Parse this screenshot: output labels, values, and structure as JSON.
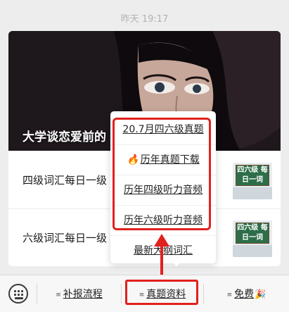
{
  "timestamp": "昨天 19:17",
  "cover": {
    "title": "大学谈恋爱前的"
  },
  "articles": [
    {
      "title": "四级词汇每日一级",
      "thumb_text": "四六级 每日一词"
    },
    {
      "title": "六级词汇每日一级",
      "thumb_text": "四六级 每日一词"
    }
  ],
  "popup_menu": {
    "items": [
      {
        "label": "20.7月四六级真题"
      },
      {
        "label": "历年真题下载",
        "icon": "fire-icon"
      },
      {
        "label": "历年四级听力音频"
      },
      {
        "label": "历年六级听力音频"
      },
      {
        "label": "最新大纲词汇"
      }
    ]
  },
  "bottom_menu": {
    "keyboard_icon": "keyboard-icon",
    "tabs": [
      {
        "label": "补报流程"
      },
      {
        "label": "真题资料"
      },
      {
        "label": "免费",
        "icon": "party-popper-icon"
      }
    ]
  },
  "colors": {
    "highlight": "#e0211d",
    "background": "#ededed",
    "fire": "#e8561c"
  }
}
